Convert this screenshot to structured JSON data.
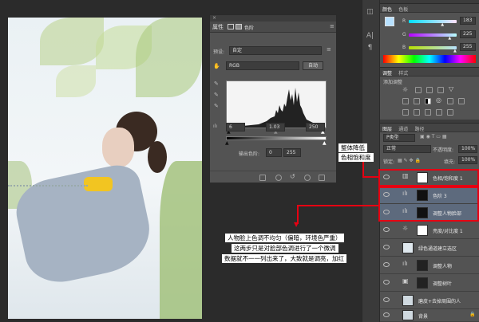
{
  "properties": {
    "tab_label": "属性",
    "panel_type": "色阶",
    "preset_label": "预设:",
    "preset_value": "自定",
    "channel_value": "RGB",
    "auto_button": "自动",
    "input_black": "6",
    "input_gamma": "1.03",
    "input_white": "250",
    "output_label": "输出色阶:",
    "output_black": "0",
    "output_white": "255"
  },
  "color_panel": {
    "tabs": [
      "颜色",
      "色板"
    ],
    "r_label": "R",
    "g_label": "G",
    "b_label": "B",
    "r_value": "183",
    "g_value": "225",
    "b_value": "255",
    "r_level": 0.718,
    "g_level": 0.882,
    "b_level": 1.0,
    "accent": "#b7e1ff"
  },
  "adjust_panel": {
    "tabs": [
      "调整",
      "样式"
    ],
    "heading": "添加调整"
  },
  "layers_panel": {
    "tabs": [
      "图层",
      "通道",
      "路径"
    ],
    "filter_label": "P类型",
    "blend_mode": "正常",
    "opacity_label": "不透明度:",
    "opacity_value": "100%",
    "lock_label": "锁定:",
    "fill_label": "填充:",
    "fill_value": "100%",
    "layers": [
      {
        "name": "色相/饱和度 1"
      },
      {
        "name": "色阶 3"
      },
      {
        "name": "调整人物脸部"
      },
      {
        "name": "亮度/对比度 1"
      },
      {
        "name": "绿色通道建立选区"
      },
      {
        "name": "调整人物"
      },
      {
        "name": "调整树叶"
      },
      {
        "name": "磨皮+去掉周围的人"
      },
      {
        "name": "背景"
      }
    ]
  },
  "annotations": {
    "top_callout_line1": "整体降低",
    "top_callout_line2": "色相饱和度",
    "mid_callout_line1": "人物脸上色调不均匀（偏暗，环境色严重）",
    "mid_callout_line2": "这两步只是对脸部色调进行了一个微调",
    "mid_callout_line3": "数据就不一一列出来了，大致就是调亮，加红",
    "line_color": "#e60012"
  }
}
